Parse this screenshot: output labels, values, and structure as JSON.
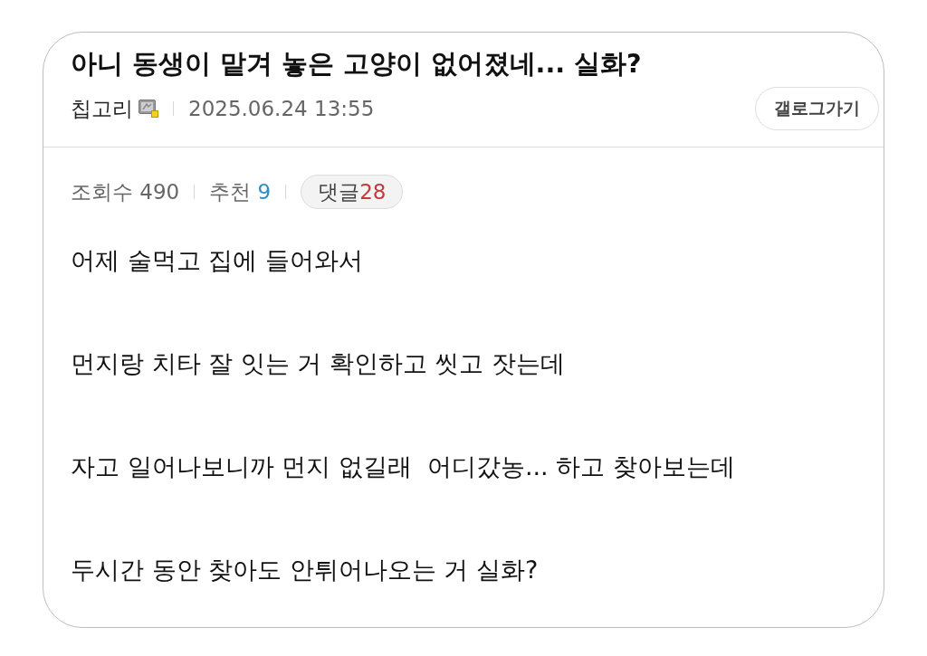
{
  "post": {
    "title": "아니 동생이 맡겨 놓은 고양이 없어졌네... 실화?",
    "author": "칩고리",
    "date": "2025.06.24 13:55",
    "gallog_button": "갤로그가기",
    "stats": [
      {
        "kind": "views",
        "label": "조회수",
        "value": "490"
      },
      {
        "kind": "recommends",
        "label": "추천",
        "value": "9"
      },
      {
        "kind": "comments",
        "label": "댓글",
        "value": "28"
      }
    ],
    "body": [
      "어제 술먹고 집에 들어와서",
      "먼지랑 치타 잘 잇는 거 확인하고 씻고 잣는데",
      "자고 일어나보니까 먼지 없길래  어디갔농... 하고 찾아보는데",
      "두시간 동안 찾아도 안튀어나오는 거 실화?"
    ]
  }
}
